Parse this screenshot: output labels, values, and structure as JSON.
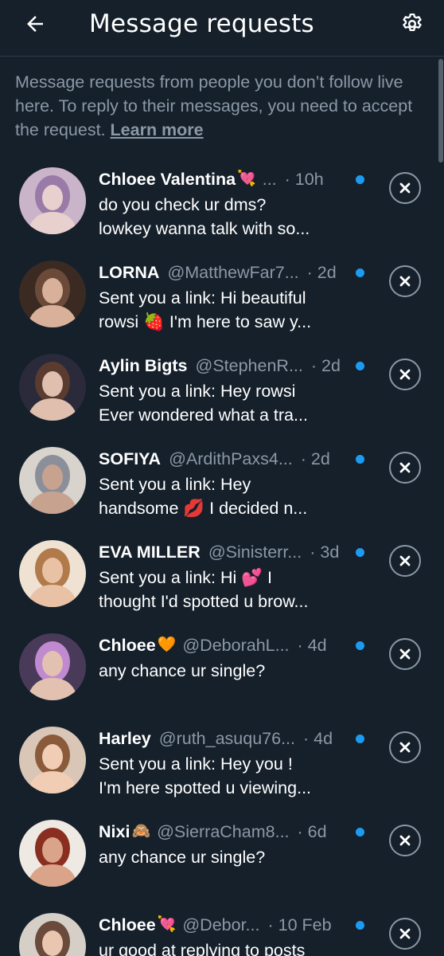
{
  "header": {
    "title": "Message requests",
    "back_icon": "arrow-left-icon",
    "settings_icon": "gear-icon"
  },
  "intro": {
    "text": "Message requests from people you don’t follow live here. To reply to their messages, you need to accept the request. ",
    "link": "Learn more"
  },
  "colors": {
    "background": "#15202b",
    "secondary_text": "#8b98a5",
    "accent_dot": "#1d9bf0"
  },
  "requests": [
    {
      "name": "Chloee Valentina",
      "emoji": "💘",
      "handle": "...",
      "time": "· 10h",
      "line1": "do you check ur dms?",
      "line2": "lowkey wanna talk with so...",
      "avatar_colors": [
        "#c9b4c9",
        "#9a7aa6",
        "#e8d0cf"
      ]
    },
    {
      "name": "LORNA",
      "emoji": "",
      "handle": "@MatthewFar7...",
      "time": "· 2d",
      "line1": "Sent you a link: Hi beautiful",
      "line2": "rowsi 🍓 I'm here to saw y...",
      "avatar_colors": [
        "#3a2a22",
        "#6b4a3a",
        "#d9b19a"
      ]
    },
    {
      "name": "Aylin Bigts",
      "emoji": "",
      "handle": "@StephenR...",
      "time": "· 2d",
      "line1": "Sent you a link: Hey rowsi",
      "line2": "Ever wondered what a tra...",
      "avatar_colors": [
        "#2a2a3a",
        "#5a3b30",
        "#e0bfae"
      ]
    },
    {
      "name": "SOFIYA",
      "emoji": "",
      "handle": "@ArdithPaxs4...",
      "time": "· 2d",
      "line1": "Sent you a link: Hey",
      "line2": "handsome 💋 I decided n...",
      "avatar_colors": [
        "#d8d3cc",
        "#8a8f9a",
        "#c7a38f"
      ]
    },
    {
      "name": "EVA MILLER",
      "emoji": "",
      "handle": "@Sinisterr...",
      "time": "· 3d",
      "line1": "Sent you a link: Hi 💕 I",
      "line2": "thought I'd spotted u brow...",
      "avatar_colors": [
        "#efe2d3",
        "#b07a4a",
        "#e9c2a5"
      ]
    },
    {
      "name": "Chloee",
      "emoji": "🧡",
      "handle": "@DeborahL...",
      "time": "· 4d",
      "line1": "any chance ur single?",
      "line2": "",
      "avatar_colors": [
        "#4a3a5a",
        "#c08ad0",
        "#e3c1b0"
      ]
    },
    {
      "name": "Harley",
      "emoji": "",
      "handle": "@ruth_asuqu76...",
      "time": "· 4d",
      "line1": "Sent you a link: Hey you !",
      "line2": "I'm here spotted u viewing...",
      "avatar_colors": [
        "#d9c6b6",
        "#8a5a3a",
        "#f0cdb4"
      ]
    },
    {
      "name": "Nixi",
      "emoji": "🙈",
      "handle": "@SierraCham8...",
      "time": "· 6d",
      "line1": "any chance ur single?",
      "line2": "",
      "avatar_colors": [
        "#efe9e4",
        "#8a2f1f",
        "#d9a489"
      ]
    },
    {
      "name": "Chloee",
      "emoji": "💘",
      "handle": "@Debor...",
      "time": "· 10 Feb",
      "line1": "ur good at replying to posts",
      "line2": "",
      "avatar_colors": [
        "#d6cfc8",
        "#6a4a3a",
        "#e9c6b0"
      ]
    }
  ],
  "row_icons": {
    "dismiss": "close-circle-icon",
    "unread": "unread-dot-icon",
    "avatar": "avatar"
  }
}
